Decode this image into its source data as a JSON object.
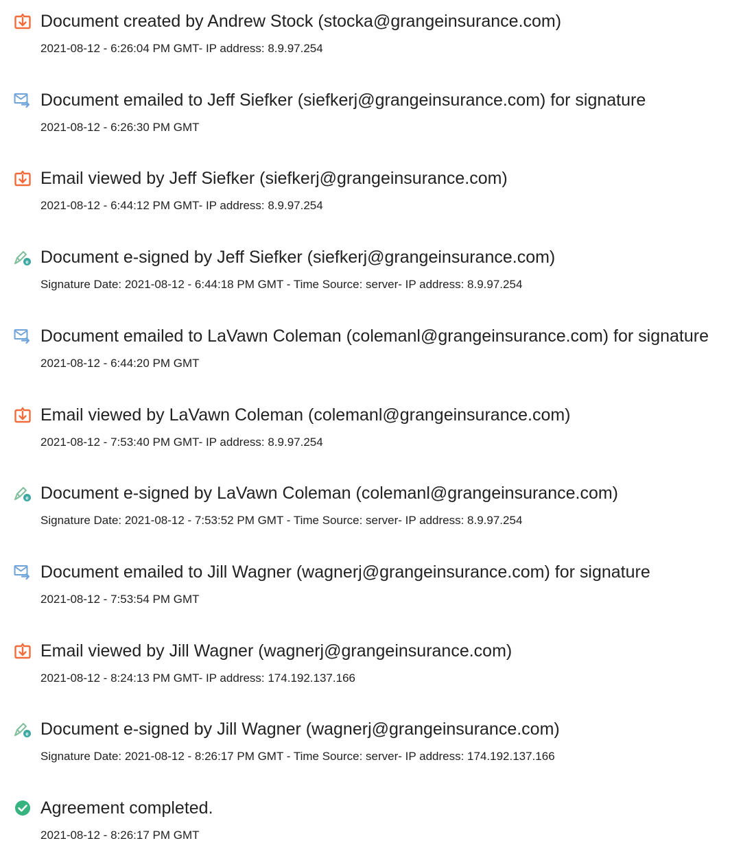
{
  "events": [
    {
      "icon": "document-created-icon",
      "title": "Document created by Andrew Stock (stocka@grangeinsurance.com)",
      "detail": "2021-08-12 - 6:26:04 PM GMT- IP address: 8.9.97.254"
    },
    {
      "icon": "email-sent-icon",
      "title": "Document emailed to Jeff Siefker (siefkerj@grangeinsurance.com) for signature",
      "detail": "2021-08-12 - 6:26:30 PM GMT"
    },
    {
      "icon": "document-viewed-icon",
      "title": "Email viewed by Jeff Siefker (siefkerj@grangeinsurance.com)",
      "detail": "2021-08-12 - 6:44:12 PM GMT- IP address: 8.9.97.254"
    },
    {
      "icon": "esign-pen-icon",
      "title": "Document e-signed by Jeff Siefker (siefkerj@grangeinsurance.com)",
      "detail": "Signature Date: 2021-08-12 - 6:44:18 PM GMT - Time Source: server- IP address: 8.9.97.254"
    },
    {
      "icon": "email-sent-icon",
      "title": "Document emailed to LaVawn Coleman (colemanl@grangeinsurance.com) for signature",
      "detail": "2021-08-12 - 6:44:20 PM GMT"
    },
    {
      "icon": "document-viewed-icon",
      "title": "Email viewed by LaVawn Coleman (colemanl@grangeinsurance.com)",
      "detail": "2021-08-12 - 7:53:40 PM GMT- IP address: 8.9.97.254"
    },
    {
      "icon": "esign-pen-icon",
      "title": "Document e-signed by LaVawn Coleman (colemanl@grangeinsurance.com)",
      "detail": "Signature Date: 2021-08-12 - 7:53:52 PM GMT - Time Source: server- IP address: 8.9.97.254"
    },
    {
      "icon": "email-sent-icon",
      "title": "Document emailed to Jill Wagner (wagnerj@grangeinsurance.com) for signature",
      "detail": "2021-08-12 - 7:53:54 PM GMT"
    },
    {
      "icon": "document-viewed-icon",
      "title": "Email viewed by Jill Wagner (wagnerj@grangeinsurance.com)",
      "detail": "2021-08-12 - 8:24:13 PM GMT- IP address: 174.192.137.166"
    },
    {
      "icon": "esign-pen-icon",
      "title": "Document e-signed by Jill Wagner (wagnerj@grangeinsurance.com)",
      "detail": "Signature Date: 2021-08-12 - 8:26:17 PM GMT - Time Source: server- IP address: 174.192.137.166"
    },
    {
      "icon": "agreement-completed-icon",
      "title": "Agreement completed.",
      "detail": "2021-08-12 - 8:26:17 PM GMT"
    }
  ],
  "colors": {
    "document_icon": "#f26b3a",
    "email_icon": "#6fa3d8",
    "pen_icon": "#7fbf9c",
    "check_icon": "#36b37e",
    "text": "#222222"
  }
}
